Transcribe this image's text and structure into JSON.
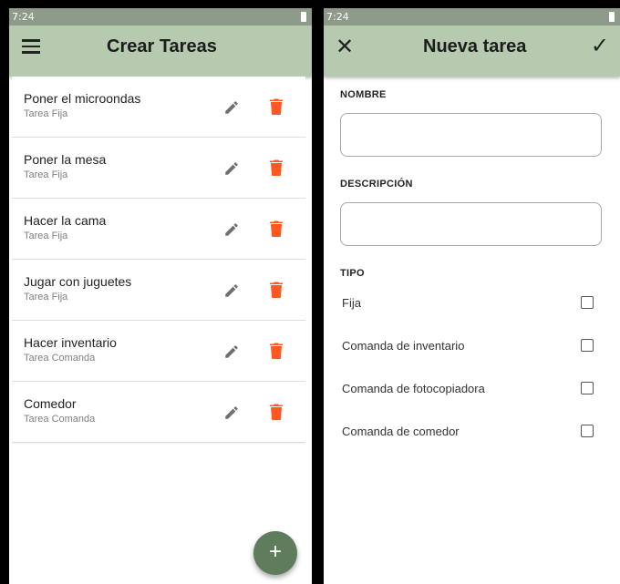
{
  "left_screen": {
    "status_time": "7:24",
    "title": "Crear Tareas",
    "tasks": [
      {
        "name": "Poner el microondas",
        "type": "Tarea Fija"
      },
      {
        "name": "Poner la mesa",
        "type": "Tarea Fija"
      },
      {
        "name": "Hacer la cama",
        "type": "Tarea Fija"
      },
      {
        "name": "Jugar con juguetes",
        "type": "Tarea Fija"
      },
      {
        "name": "Hacer inventario",
        "type": "Tarea Comanda"
      },
      {
        "name": "Comedor",
        "type": "Tarea Comanda"
      }
    ],
    "fab_label": "+"
  },
  "right_screen": {
    "status_time": "7:24",
    "title": "Nueva tarea",
    "close_glyph": "✕",
    "confirm_glyph": "✓",
    "nombre_label": "NOMBRE",
    "nombre_value": "",
    "descripcion_label": "DESCRIPCIÓN",
    "descripcion_value": "",
    "tipo_label": "TIPO",
    "tipo_options": [
      {
        "label": "Fija",
        "checked": false
      },
      {
        "label": "Comanda de inventario",
        "checked": false
      },
      {
        "label": "Comanda de fotocopiadora",
        "checked": false
      },
      {
        "label": "Comanda de comedor",
        "checked": false
      }
    ]
  },
  "icons": {
    "menu": "hamburger-menu-icon",
    "edit": "pencil-icon",
    "delete": "trash-icon",
    "add": "plus-icon",
    "close": "close-icon",
    "confirm": "check-icon",
    "battery": "battery-icon"
  },
  "colors": {
    "app_bar": "#b6cab0",
    "status_bar": "#8f9b8a",
    "delete_icon": "#ff5722",
    "edit_icon": "#6f6f6f",
    "fab": "#5f7d5c"
  }
}
